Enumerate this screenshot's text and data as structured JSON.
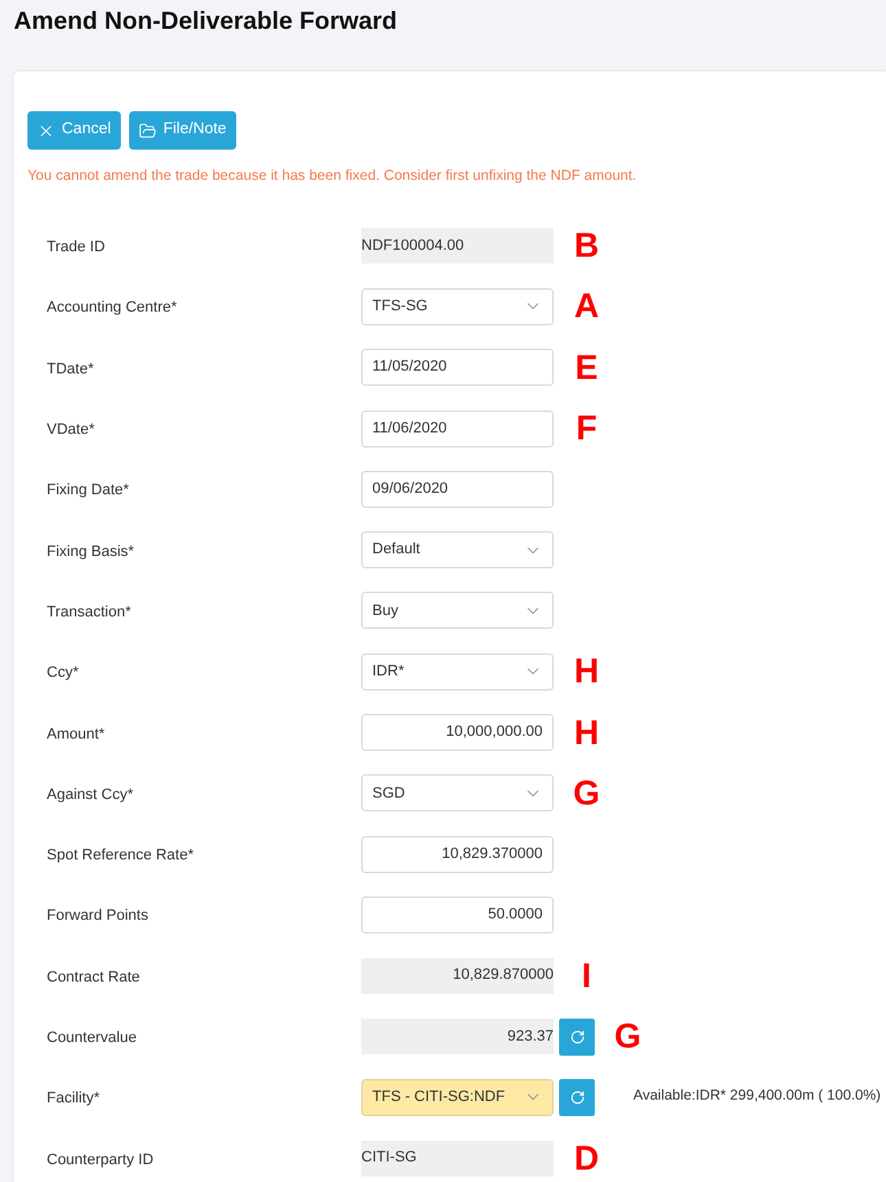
{
  "title": "Amend Non-Deliverable Forward",
  "actions": [
    {
      "label": "Cancel"
    },
    {
      "label": "File/Note"
    }
  ],
  "warning": "You cannot amend the trade because it has been fixed. Consider first unfixing the NDF amount.",
  "fields": [
    {
      "label": "Trade ID",
      "kind": "readonly_text",
      "value": "NDF100004.00",
      "highlighted": false,
      "refresh_button": false,
      "annotation": "B"
    },
    {
      "label": "Accounting Centre*",
      "kind": "select",
      "value": "TFS-SG",
      "highlighted": false,
      "refresh_button": false,
      "annotation": "A"
    },
    {
      "label": "TDate*",
      "kind": "date",
      "value": "11/05/2020",
      "highlighted": false,
      "refresh_button": false,
      "annotation": "E"
    },
    {
      "label": "VDate*",
      "kind": "date",
      "value": "11/06/2020",
      "highlighted": false,
      "refresh_button": false,
      "annotation": "F"
    },
    {
      "label": "Fixing Date*",
      "kind": "date",
      "value": "09/06/2020",
      "highlighted": false,
      "refresh_button": false
    },
    {
      "label": "Fixing Basis*",
      "kind": "select",
      "value": "Default",
      "highlighted": false,
      "refresh_button": false
    },
    {
      "label": "Transaction*",
      "kind": "select",
      "value": "Buy",
      "highlighted": false,
      "refresh_button": false
    },
    {
      "label": "Ccy*",
      "kind": "select",
      "value": "IDR*",
      "highlighted": false,
      "refresh_button": false,
      "annotation": "H"
    },
    {
      "label": "Amount*",
      "kind": "number",
      "value": "10,000,000.00",
      "highlighted": false,
      "refresh_button": false,
      "annotation": "H"
    },
    {
      "label": "Against Ccy*",
      "kind": "select",
      "value": "SGD",
      "highlighted": false,
      "refresh_button": false,
      "annotation": "G"
    },
    {
      "label": "Spot Reference Rate*",
      "kind": "number",
      "value": "10,829.370000",
      "highlighted": false,
      "refresh_button": false
    },
    {
      "label": "Forward Points",
      "kind": "number",
      "value": "50.0000",
      "highlighted": false,
      "refresh_button": false
    },
    {
      "label": "Contract Rate",
      "kind": "readonly_number",
      "value": "10,829.870000",
      "highlighted": false,
      "refresh_button": false,
      "annotation": "I"
    },
    {
      "label": "Countervalue",
      "kind": "readonly_number",
      "value": "923.37",
      "highlighted": false,
      "refresh_button": true,
      "annotation": "G"
    },
    {
      "label": "Facility*",
      "kind": "select",
      "value": "TFS - CITI-SG:NDF",
      "highlighted": true,
      "refresh_button": true,
      "note": "Available:IDR* 299,400.00m ( 100.0%)"
    },
    {
      "label": "Counterparty ID",
      "kind": "readonly_text",
      "value": "CITI-SG",
      "highlighted": false,
      "refresh_button": false,
      "annotation": "D"
    }
  ]
}
